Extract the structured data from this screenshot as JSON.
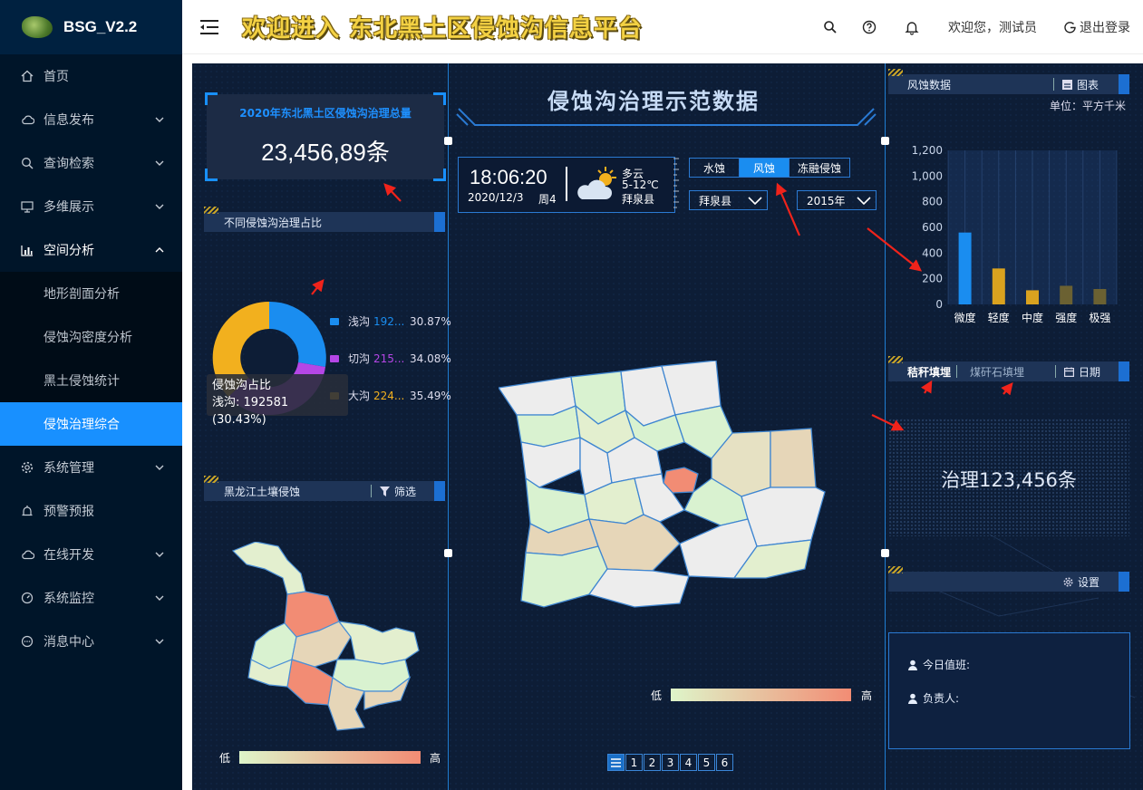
{
  "app": {
    "logo_text": "BSG_V2.2",
    "page_title": "欢迎进入 东北黑土区侵蚀沟信息平台"
  },
  "sidebar": {
    "items": [
      {
        "label": "首页",
        "icon": "home-icon"
      },
      {
        "label": "信息发布",
        "icon": "cloud-icon"
      },
      {
        "label": "查询检索",
        "icon": "search-icon"
      },
      {
        "label": "多维展示",
        "icon": "monitor-icon"
      },
      {
        "label": "空间分析",
        "icon": "bar-chart-icon"
      },
      {
        "label": "系统管理",
        "icon": "gear-icon"
      },
      {
        "label": "预警预报",
        "icon": "alarm-icon"
      },
      {
        "label": "在线开发",
        "icon": "cloud-icon"
      },
      {
        "label": "系统监控",
        "icon": "dashboard-icon"
      },
      {
        "label": "消息中心",
        "icon": "message-icon"
      }
    ],
    "submenu": [
      "地形剖面分析",
      "侵蚀沟密度分析",
      "黑土侵蚀统计",
      "侵蚀治理综合"
    ]
  },
  "header": {
    "welcome": "欢迎您，测试员",
    "logout": "退出登录"
  },
  "left": {
    "total_label": "2020年东北黑土区侵蚀沟治理总量",
    "total_value": "23,456,89条",
    "pie_title": "不同侵蚀沟治理占比",
    "pie": [
      {
        "name": "浅沟",
        "value": "192...",
        "pct": "30.87%",
        "color": "#1a8df0"
      },
      {
        "name": "切沟",
        "value": "215...",
        "pct": "34.08%",
        "color": "#b546e6"
      },
      {
        "name": "大沟",
        "value": "224...",
        "pct": "35.49%",
        "color": "#f2b01e"
      }
    ],
    "tooltip_title": "侵蚀沟占比",
    "tooltip_value": "浅沟: 192581 (30.43%)",
    "map_title": "黑龙江土壤侵蚀",
    "filter": "筛选",
    "low": "低",
    "high": "高"
  },
  "center": {
    "title": "侵蚀沟治理示范数据",
    "time": "18:06:20",
    "date": "2020/12/3",
    "weekday": "周4",
    "weather": "多云",
    "temp": "5-12℃",
    "city": "拜泉县",
    "tabs": [
      "水蚀",
      "风蚀",
      "冻融侵蚀"
    ],
    "county": "拜泉县",
    "year": "2015年",
    "low": "低",
    "high": "高",
    "pages": [
      "1",
      "2",
      "3",
      "4",
      "5",
      "6"
    ]
  },
  "right": {
    "wind_title": "风蚀数据",
    "chart_btn": "图表",
    "unit": "单位：平方千米",
    "tab_straw": "秸秆填埋",
    "tab_stone": "煤矸石填埋",
    "date_btn": "日期",
    "governance": "治理123,456条",
    "settings": "设置",
    "duty": "今日值班:",
    "leader": "负责人:"
  },
  "chart_data": {
    "type": "bar",
    "categories": [
      "微度",
      "轻度",
      "中度",
      "强度",
      "极强"
    ],
    "values": [
      560,
      280,
      110,
      145,
      120
    ],
    "colors": [
      "#1a8df0",
      "#d9a21f",
      "#d9a21f",
      "#6b6132",
      "#6b6132"
    ],
    "yticks": [
      "0",
      "200",
      "400",
      "600",
      "800",
      "1,000",
      "1,200"
    ],
    "ylim": [
      0,
      1200
    ]
  }
}
